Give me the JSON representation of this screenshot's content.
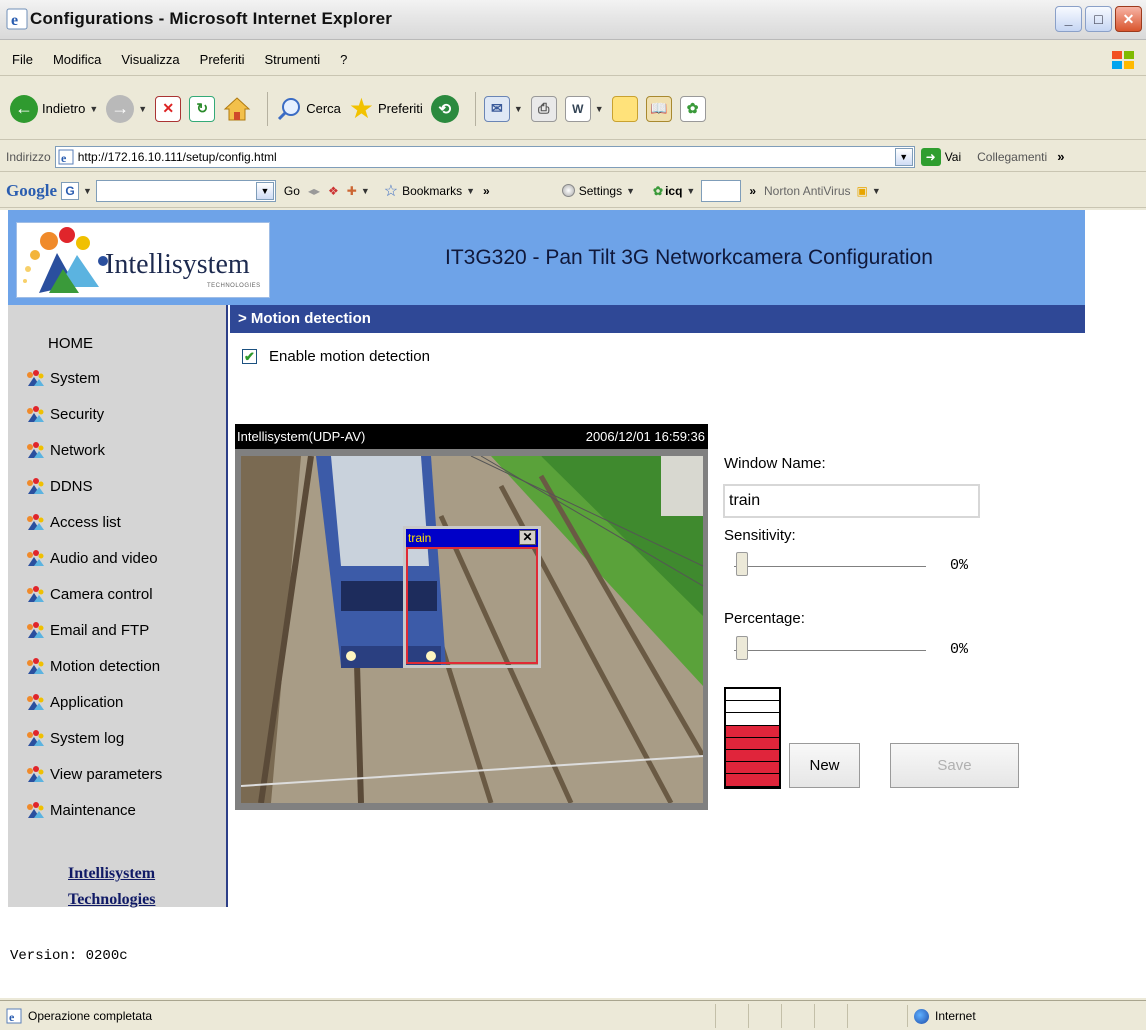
{
  "window": {
    "title": "Configurations - Microsoft Internet Explorer"
  },
  "menu": [
    "File",
    "Modifica",
    "Visualizza",
    "Preferiti",
    "Strumenti",
    "?"
  ],
  "toolbar": {
    "back": "Indietro",
    "search": "Cerca",
    "favorites": "Preferiti"
  },
  "address": {
    "label": "Indirizzo",
    "url": "http://172.16.10.111/setup/config.html",
    "go": "Vai",
    "links": "Collegamenti"
  },
  "google_bar": {
    "logo": "Google",
    "go": "Go",
    "bookmarks": "Bookmarks",
    "settings": "Settings",
    "icq": "icq",
    "norton": "Norton AntiVirus"
  },
  "header": {
    "logo_text": "Intellisystem",
    "logo_sub": "TECHNOLOGIES",
    "title": "IT3G320 - Pan Tilt 3G Networkcamera Configuration"
  },
  "sidebar": {
    "home": "HOME",
    "items": [
      "System",
      "Security",
      "Network",
      "DDNS",
      "Access list",
      "Audio and video",
      "Camera control",
      "Email and FTP",
      "Motion detection",
      "Application",
      "System log",
      "View parameters",
      "Maintenance"
    ],
    "link_line1": "Intellisystem",
    "link_line2": "Technologies",
    "version": "Version: 0200c"
  },
  "section": {
    "title": "> Motion detection"
  },
  "enable": {
    "label": "Enable motion detection",
    "checked": true
  },
  "video": {
    "source": "Intellisystem(UDP-AV)",
    "timestamp": "2006/12/01 16:59:36"
  },
  "motion_window": {
    "name": "train"
  },
  "form": {
    "window_name_label": "Window Name:",
    "window_name_value": "train",
    "sensitivity_label": "Sensitivity:",
    "sensitivity_value": "0%",
    "percentage_label": "Percentage:",
    "percentage_value": "0%",
    "new_button": "New",
    "save_button": "Save"
  },
  "meter": {
    "total_segments": 8,
    "filled_segments": 5
  },
  "status": {
    "text": "Operazione completata",
    "zone": "Internet"
  }
}
